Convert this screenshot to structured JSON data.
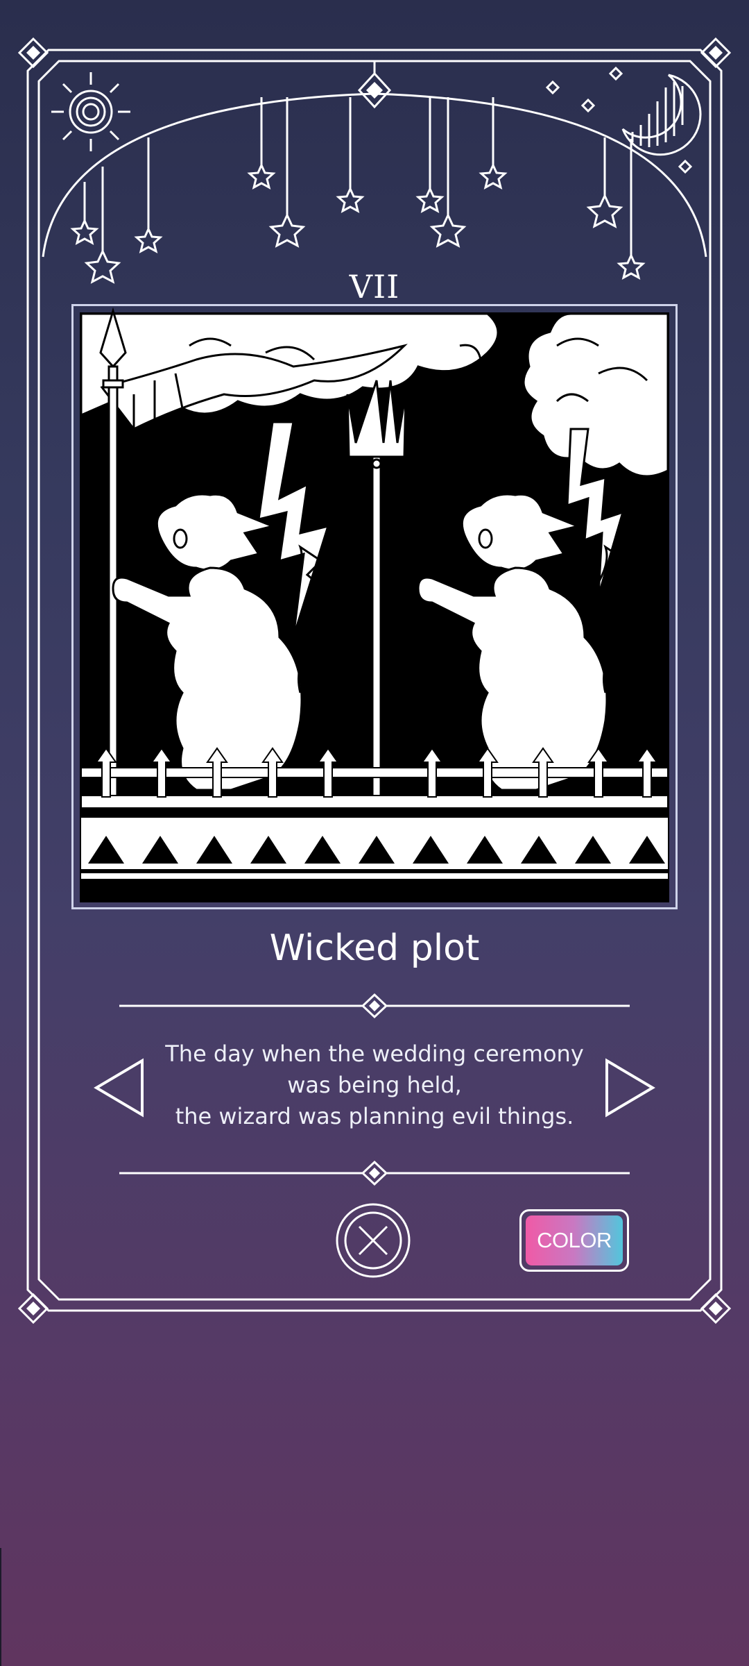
{
  "card": {
    "numeral": "VII",
    "title": "Wicked plot",
    "description": [
      "The day when the wedding ceremony",
      "was being held,",
      "the wizard was planning evil things."
    ]
  },
  "buttons": {
    "color_label": "COLOR"
  },
  "icons": {
    "prev": "triangle-left-icon",
    "next": "triangle-right-icon",
    "close": "close-circle-icon",
    "sun": "sun-icon",
    "moon": "crescent-moon-icon",
    "stars": "hanging-stars-icon"
  },
  "colors": {
    "line": "#ffffff",
    "background_top": "#2a2e4d",
    "background_bottom": "#60355f",
    "color_button_start": "#f05aa6",
    "color_button_end": "#52c6dc"
  }
}
